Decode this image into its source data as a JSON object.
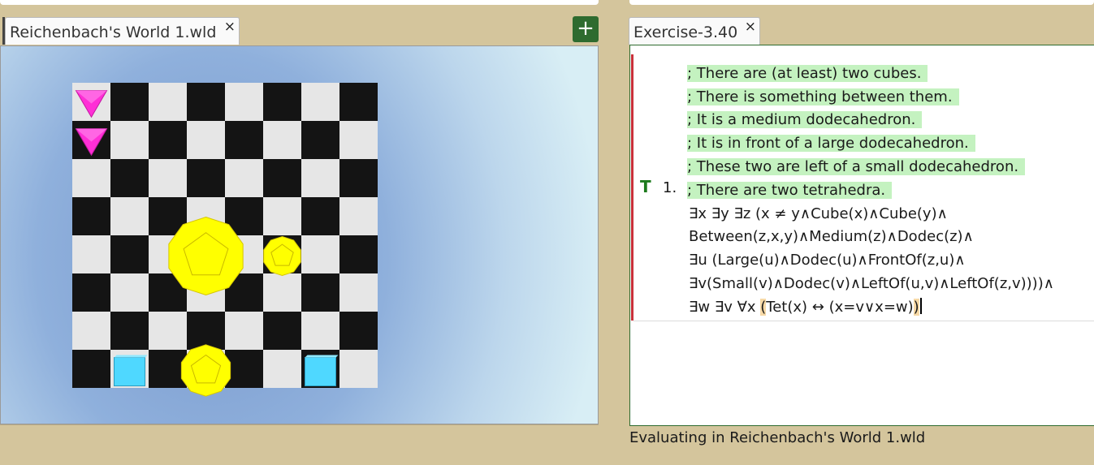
{
  "world_tab": {
    "title": "Reichenbach's World 1.wld",
    "close": "×"
  },
  "add_button": "+",
  "exercise_tab": {
    "title": "Exercise-3.40",
    "close": "×"
  },
  "editor": {
    "truth_mark": "T",
    "line_number": "1.",
    "comments": [
      "; There are (at least) two cubes.",
      "; There is something between them.",
      "; It is a medium dodecahedron.",
      "; It is in front of a large dodecahedron.",
      "; These two are left of a small dodecahedron.",
      "; There are two tetrahedra."
    ],
    "formula": [
      "∃x ∃y ∃z (x ≠ y∧Cube(x)∧Cube(y)∧",
      "Between(z,x,y)∧Medium(z)∧Dodec(z)∧",
      "∃u (Large(u)∧Dodec(u)∧FrontOf(z,u)∧",
      "∃v(Small(v)∧Dodec(v)∧LeftOf(u,v)∧LeftOf(z,v))))∧"
    ],
    "last_line": {
      "prefix": "∃w ∃v ∀x ",
      "open_paren": "(",
      "middle": "Tet(x) ↔ (x=v∨x=w)",
      "close_paren": ")"
    }
  },
  "status": "Evaluating in Reichenbach's World 1.wld",
  "colors": {
    "tetrahedron": "#ff2fd6",
    "dodecahedron": "#ffff00",
    "cube": "#4fd8ff",
    "accent_green": "#2e6b2f"
  },
  "pieces": [
    {
      "shape": "tetrahedron",
      "size": "small",
      "col": 0,
      "row": 0
    },
    {
      "shape": "tetrahedron",
      "size": "small",
      "col": 0,
      "row": 1
    },
    {
      "shape": "dodecahedron",
      "size": "large",
      "col": 3,
      "row": 4
    },
    {
      "shape": "dodecahedron",
      "size": "small",
      "col": 5,
      "row": 4
    },
    {
      "shape": "dodecahedron",
      "size": "medium",
      "col": 3,
      "row": 7
    },
    {
      "shape": "cube",
      "size": "small",
      "col": 1,
      "row": 7
    },
    {
      "shape": "cube",
      "size": "small",
      "col": 6,
      "row": 7
    }
  ]
}
